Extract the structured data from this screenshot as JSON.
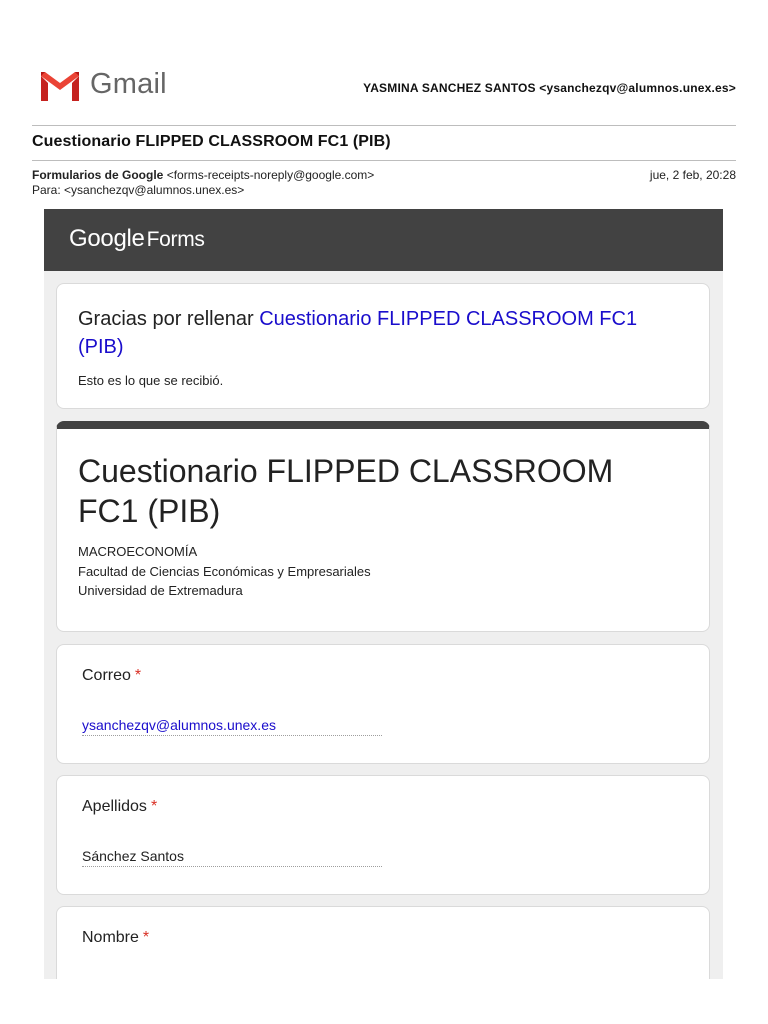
{
  "gmail": {
    "brand": "Gmail",
    "account": "YASMINA SANCHEZ SANTOS <ysanchezqv@alumnos.unex.es>"
  },
  "email": {
    "subject": "Cuestionario FLIPPED CLASSROOM FC1 (PIB)",
    "sender_name": "Formularios de Google",
    "sender_address": "<forms-receipts-noreply@google.com>",
    "to": "Para: <ysanchezqv@alumnos.unex.es>",
    "date": "jue, 2 feb, 20:28"
  },
  "forms": {
    "logo_google": "Google",
    "logo_forms": "Forms",
    "thanks_prefix": "Gracias por rellenar ",
    "thanks_link": "Cuestionario FLIPPED CLASSROOM FC1 (PIB)",
    "received_note": "Esto es lo que se recibió.",
    "form_title": "Cuestionario FLIPPED CLASSROOM FC1 (PIB)",
    "description": [
      "MACROECONOMÍA",
      "Facultad de Ciencias Económicas y Empresariales",
      "Universidad de Extremadura"
    ],
    "required_marker": "*",
    "questions": [
      {
        "label": "Correo",
        "answer": "ysanchezqv@alumnos.unex.es"
      },
      {
        "label": "Apellidos",
        "answer": "Sánchez Santos"
      },
      {
        "label": "Nombre",
        "answer": ""
      }
    ]
  },
  "colors": {
    "gmail_red": "#ea4335",
    "forms_bar": "#424242",
    "link_blue": "#1a0dcc",
    "required_red": "#d93025"
  }
}
